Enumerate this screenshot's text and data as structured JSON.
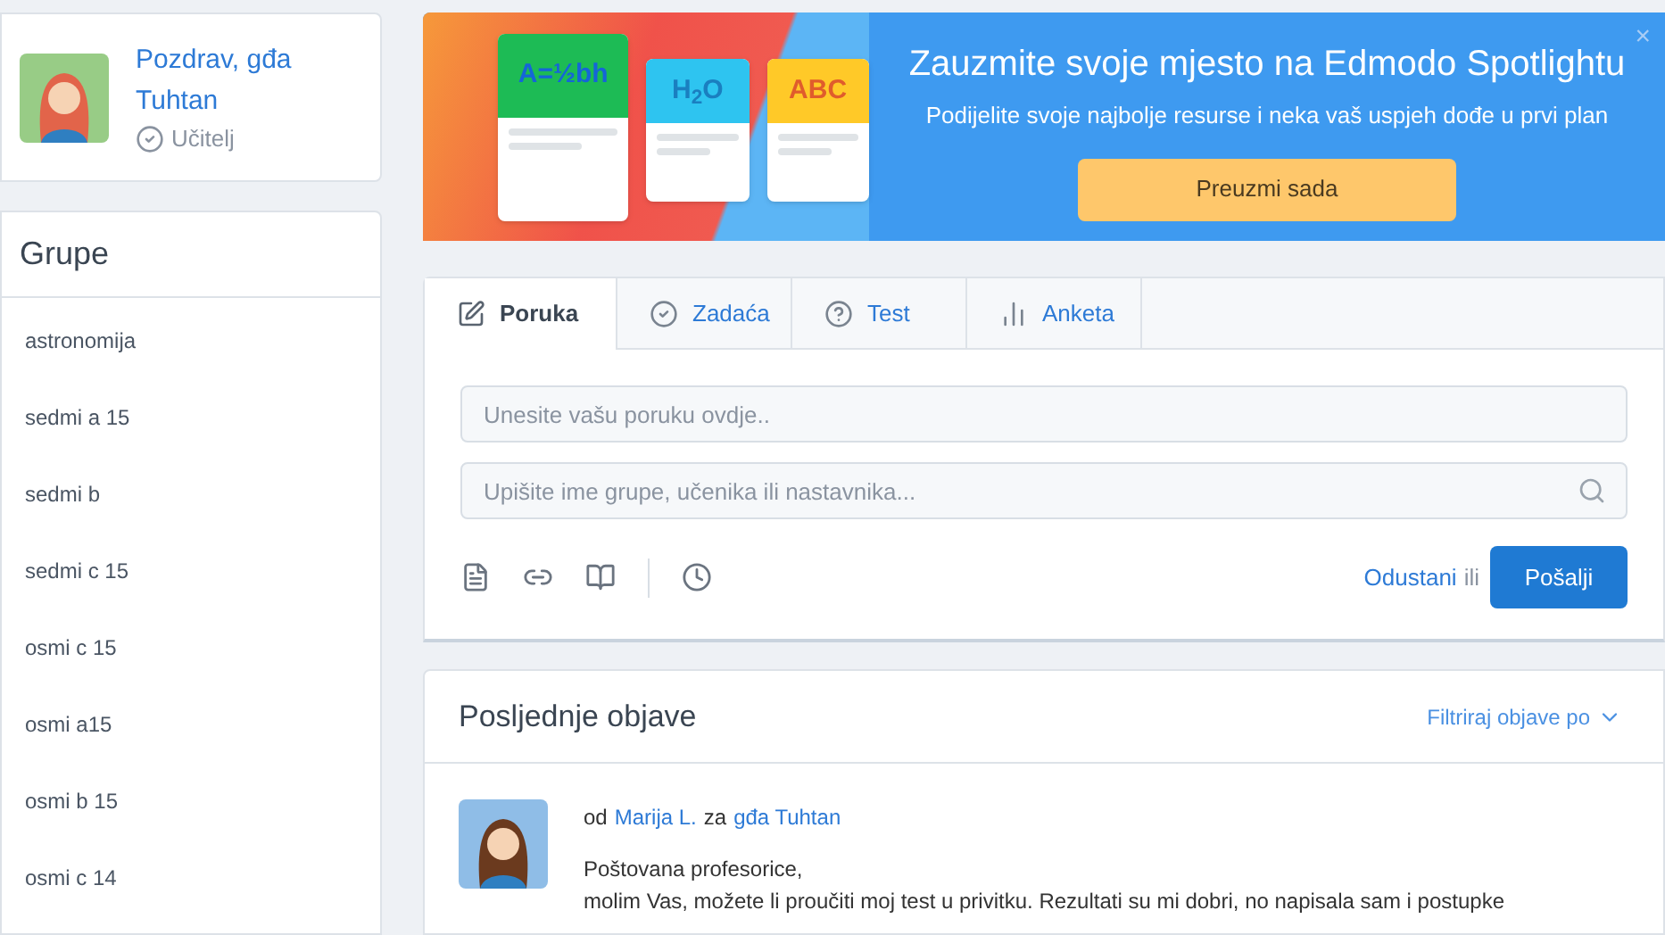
{
  "profile": {
    "greeting": "Pozdrav, gđa Tuhtan",
    "role": "Učitelj"
  },
  "groups": {
    "title": "Grupe",
    "items": [
      {
        "label": "astronomija"
      },
      {
        "label": "sedmi a 15"
      },
      {
        "label": "sedmi b"
      },
      {
        "label": "sedmi c 15"
      },
      {
        "label": "osmi c 15"
      },
      {
        "label": "osmi a15"
      },
      {
        "label": "osmi b 15"
      },
      {
        "label": "osmi c 14"
      }
    ]
  },
  "banner": {
    "cards": [
      {
        "label": "A=½bh",
        "kind": "green"
      },
      {
        "label": "H$_{2}$O",
        "kind": "blue"
      },
      {
        "label": "ABC",
        "kind": "yellow"
      }
    ],
    "title": "Zauzmite svoje mjesto na Edmodo Spotlightu",
    "subtitle": "Podijelite svoje najbolje resurse i neka vaš uspjeh dođe u prvi plan",
    "button": "Preuzmi sada",
    "close": "×"
  },
  "composer": {
    "tabs": [
      {
        "label": "Poruka",
        "kind": "note",
        "selected": true
      },
      {
        "label": "Zadaća",
        "kind": "check",
        "selected": false
      },
      {
        "label": "Test",
        "kind": "question",
        "selected": false
      },
      {
        "label": "Anketa",
        "kind": "poll",
        "selected": false
      }
    ],
    "message": {
      "placeholder": "Unesite vašu poruku ovdje.."
    },
    "recipients": {
      "placeholder": "Upišite ime grupe, učenika ili nastavnika..."
    },
    "cancel": "Odustani",
    "or": "ili",
    "send": "Pošalji"
  },
  "posts": {
    "title": "Posljednje objave",
    "filter": "Filtriraj objave po",
    "items": [
      {
        "from_prefix": "od",
        "author": "Marija L.",
        "to_prefix": "za",
        "recipient": "gđa Tuhtan",
        "lines": [
          "Poštovana profesorice,",
          "molim Vas, možete li proučiti moj test u privitku. Rezultati su mi dobri, no napisala sam i postupke"
        ]
      }
    ]
  }
}
